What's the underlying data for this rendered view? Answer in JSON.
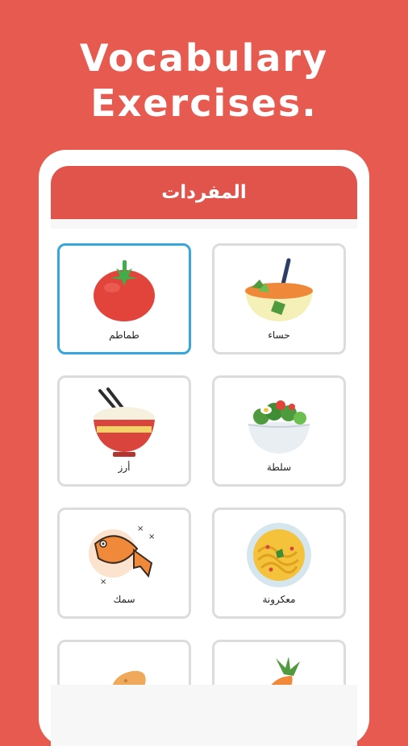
{
  "header": {
    "line1": "Vocabulary",
    "line2": "Exercises."
  },
  "appbar": {
    "title": "المفردات"
  },
  "cards": [
    {
      "label": "طماطم",
      "icon": "tomato-icon",
      "selected": true
    },
    {
      "label": "حساء",
      "icon": "soup-icon",
      "selected": false
    },
    {
      "label": "أرز",
      "icon": "rice-bowl-icon",
      "selected": false
    },
    {
      "label": "سلطة",
      "icon": "salad-icon",
      "selected": false
    },
    {
      "label": "سمك",
      "icon": "fish-icon",
      "selected": false
    },
    {
      "label": "معكرونة",
      "icon": "pasta-icon",
      "selected": false
    },
    {
      "label": "",
      "icon": "potato-icon",
      "selected": false
    },
    {
      "label": "",
      "icon": "carrot-icon",
      "selected": false
    }
  ],
  "colors": {
    "background": "#e65a50",
    "appbar": "#e0544c",
    "selected_border": "#36a6dc",
    "card_border": "#dcdcdc"
  }
}
